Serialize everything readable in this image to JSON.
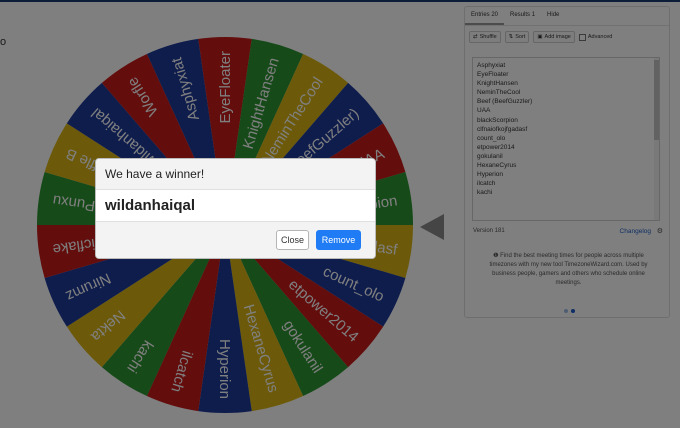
{
  "page": {
    "marker": "o"
  },
  "wheel": {
    "colors": [
      "#1e3a9a",
      "#c71a1a",
      "#2c9432",
      "#d9b514"
    ],
    "entries": [
      "Asphyxiat",
      "EyeFloater",
      "KnightHansen",
      "NeminTheCool",
      "Beef (BeefGuzzler)",
      "UAA",
      "blackScorpion",
      "clfnaiofkojfgadasf",
      "count_olo",
      "etpower2014",
      "gokulanil",
      "HexaneCyrus",
      "Hyperion",
      "ilcatch",
      "kachi",
      "Nekta",
      "Nirumz",
      "Psychicflake",
      "Punxu",
      "Waffle B",
      "wildanhaiqal",
      "Worfle"
    ],
    "center_color": "#3d3d3d"
  },
  "sidebar": {
    "tabs": [
      "Entries 20",
      "Results 1",
      "Hide"
    ],
    "toolbar": {
      "shuffle": "Shuffle",
      "sort": "Sort",
      "add_image": "Add image",
      "advanced": "Advanced"
    },
    "list": [
      "Asphyxiat",
      "EyeFloater",
      "KnightHansen",
      "NeminTheCool",
      "Beef (BeefGuzzler)",
      "UAA",
      "blackScorpion",
      "clfnaiofkojfgadasf",
      "count_olo",
      "etpower2014",
      "gokulanil",
      "HexaneCyrus",
      "Hyperion",
      "ilcatch",
      "kachi"
    ],
    "version": "Version 181",
    "changelog": "Changelog",
    "info": "Find the best meeting times for people across multiple timezones with my new tool TimezoneWizard.com. Used by business people, gamers and others who schedule online meetings."
  },
  "modal": {
    "title": "We have a winner!",
    "winner": "wildanhaiqal",
    "close_label": "Close",
    "remove_label": "Remove"
  }
}
